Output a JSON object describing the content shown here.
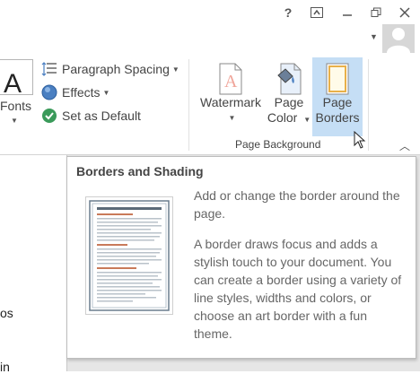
{
  "titlebar": {
    "help_label": "?",
    "ribbon_display_icon": "ribbon-display-icon",
    "minimize_icon": "minimize-icon",
    "restore_icon": "restore-icon",
    "close_icon": "close-icon"
  },
  "ribbon": {
    "fonts": {
      "glyph": "A",
      "label": "Fonts"
    },
    "document_formatting": {
      "paragraph_spacing": "Paragraph Spacing",
      "effects": "Effects",
      "set_as_default": "Set as Default"
    },
    "page_background": {
      "watermark_label": "Watermark",
      "page_color_line1": "Page",
      "page_color_line2": "Color",
      "page_borders_line1": "Page",
      "page_borders_line2": "Borders",
      "group_label": "Page Background"
    }
  },
  "document": {
    "visible_fragments": [
      "os",
      "in"
    ]
  },
  "tooltip": {
    "title": "Borders and Shading",
    "para1": "Add or change the border around the page.",
    "para2": "A border draws focus and adds a stylish touch to your document. You can create a border using a variety of line styles, widths and colors, or choose an art border with a fun theme."
  },
  "colors": {
    "accent_hover": "#c5def5",
    "set_default_green": "#3a9a5a",
    "effects_blue": "#4a7fc1"
  }
}
